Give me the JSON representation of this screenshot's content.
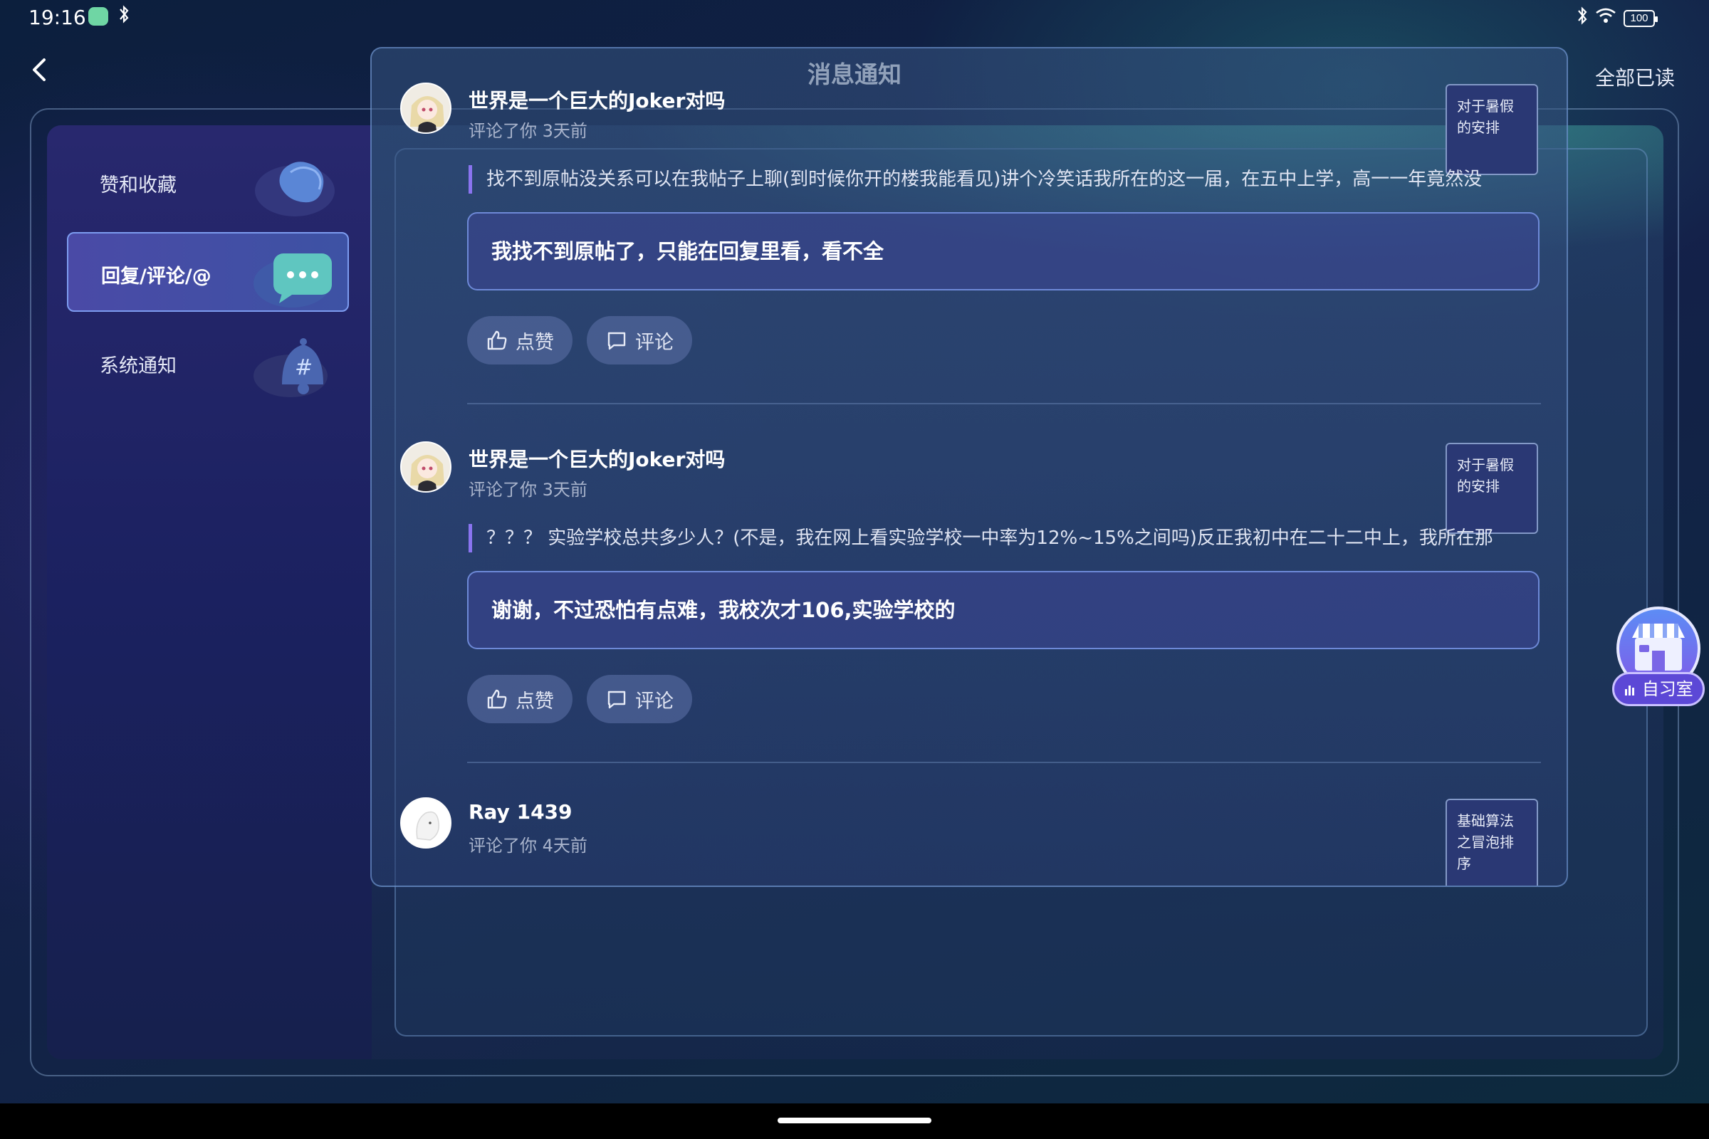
{
  "status_bar": {
    "time": "19:16",
    "battery": "100"
  },
  "header": {
    "title": "消息通知",
    "mark_all_read": "全部已读"
  },
  "sidebar": {
    "items": [
      {
        "label": "赞和收藏",
        "icon": "heart-icon",
        "active": false
      },
      {
        "label": "回复/评论/@",
        "icon": "chat-bubble-icon",
        "active": true
      },
      {
        "label": "系统通知",
        "icon": "bell-icon",
        "active": false
      }
    ]
  },
  "notifications": [
    {
      "username": "世界是一个巨大的Joker对吗",
      "meta": "评论了你 3天前",
      "post": "对于暑假的安排",
      "quote": "找不到原帖没关系可以在我帖子上聊(到时候你开的楼我能看见)讲个冷笑话我所在的这一届，在五中上学，高一一年竟然没",
      "reply": "我找不到原帖了，只能在回复里看，看不全",
      "like_label": "点赞",
      "comment_label": "评论"
    },
    {
      "username": "世界是一个巨大的Joker对吗",
      "meta": "评论了你 3天前",
      "post": "对于暑假的安排",
      "quote": "？？？ 实验学校总共多少人？(不是，我在网上看实验学校一中率为12%~15%之间吗)反正我初中在二十二中上，我所在那",
      "reply": "谢谢，不过恐怕有点难，我校次才106,实验学校的",
      "like_label": "点赞",
      "comment_label": "评论"
    },
    {
      "username": "Ray 1439",
      "meta": "评论了你 4天前",
      "post": "基础算法之冒泡排序"
    }
  ],
  "floating_widget": {
    "label": "自习室"
  },
  "colors": {
    "accent": "#8a74f0",
    "active_tab": "#4a4aa6",
    "reply_border": "#7896e6"
  }
}
